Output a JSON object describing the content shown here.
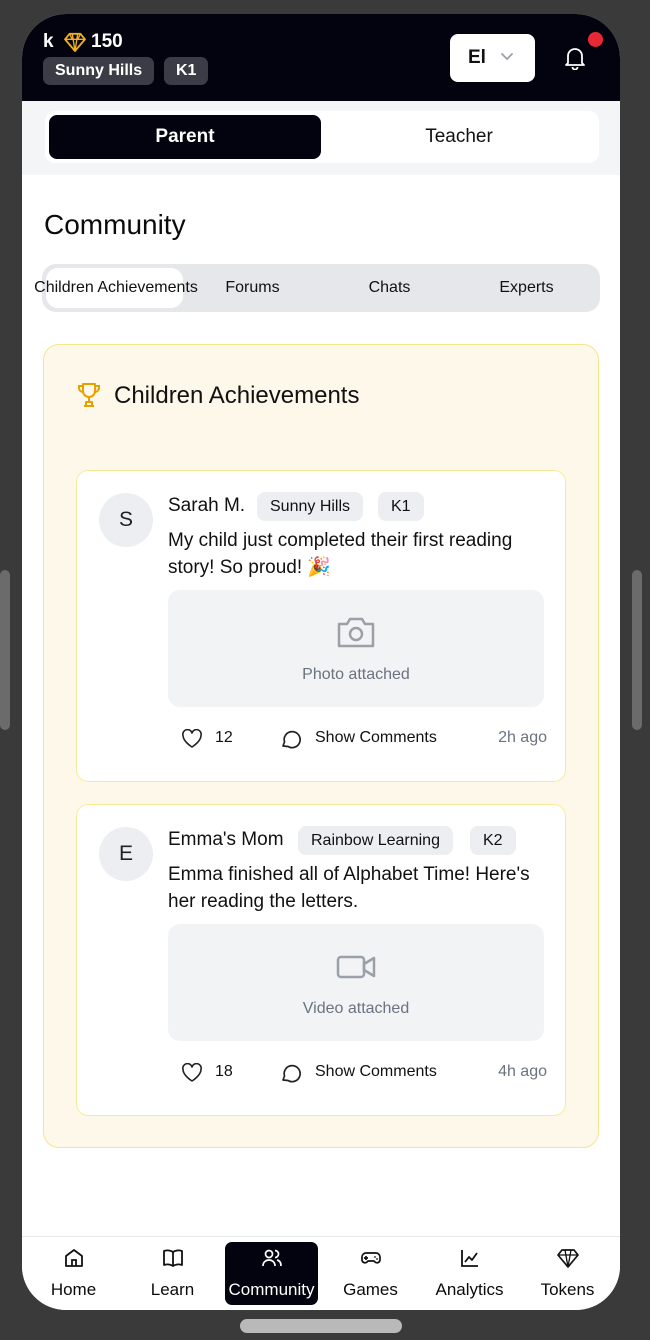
{
  "header": {
    "user_initial": "k",
    "token_count": "150",
    "school": "Sunny Hills",
    "grade": "K1",
    "language": "El",
    "gem_icon": "gem-icon",
    "notification_icon": "bell-icon"
  },
  "role_toggle": {
    "parent_label": "Parent",
    "teacher_label": "Teacher",
    "active": "Parent"
  },
  "page": {
    "title": "Community"
  },
  "tabs": [
    {
      "label": "Children Achievements",
      "active": true
    },
    {
      "label": "Forums",
      "active": false
    },
    {
      "label": "Chats",
      "active": false
    },
    {
      "label": "Experts",
      "active": false
    }
  ],
  "section": {
    "title": "Children Achievements",
    "icon": "trophy-icon"
  },
  "posts": [
    {
      "avatar": "S",
      "author": "Sarah M.",
      "school": "Sunny Hills",
      "grade": "K1",
      "text": "My child just completed their first reading story! So proud! 🎉",
      "media_icon": "camera-icon",
      "media_label": "Photo attached",
      "likes": "12",
      "comments_label": "Show Comments",
      "time": "2h ago"
    },
    {
      "avatar": "E",
      "author": "Emma's Mom",
      "school": "Rainbow Learning",
      "grade": "K2",
      "text": "Emma finished all of Alphabet Time! Here's her reading the letters.",
      "media_icon": "video-icon",
      "media_label": "Video attached",
      "likes": "18",
      "comments_label": "Show Comments",
      "time": "4h ago"
    }
  ],
  "bottom_nav": [
    {
      "label": "Home",
      "icon": "home-icon",
      "active": false
    },
    {
      "label": "Learn",
      "icon": "book-icon",
      "active": false
    },
    {
      "label": "Community",
      "icon": "users-icon",
      "active": true
    },
    {
      "label": "Games",
      "icon": "gamepad-icon",
      "active": false
    },
    {
      "label": "Analytics",
      "icon": "chart-icon",
      "active": false
    },
    {
      "label": "Tokens",
      "icon": "gem-icon",
      "active": false
    }
  ],
  "colors": {
    "header_bg": "#02030f",
    "accent_gold": "#e6a100",
    "panel_bg": "#fef8eb",
    "notification": "#e62935"
  }
}
